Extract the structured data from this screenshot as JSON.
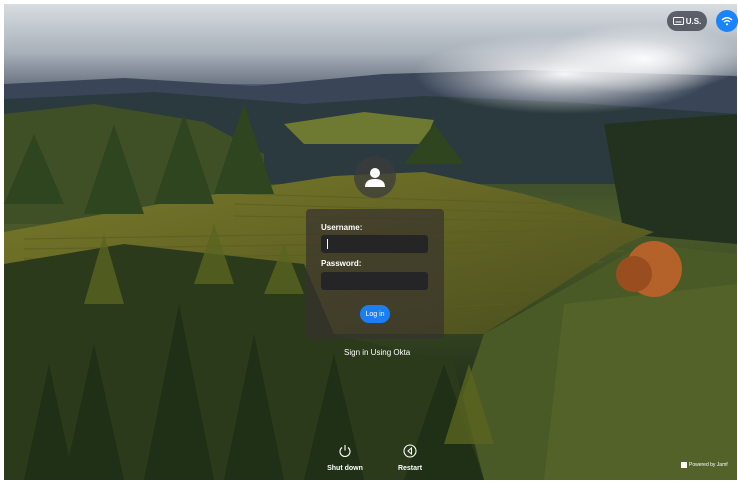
{
  "topbar": {
    "keyboard_layout": "U.S.",
    "icons": [
      "keyboard-icon",
      "wifi-icon"
    ]
  },
  "login": {
    "username_label": "Username:",
    "username_value": "",
    "password_label": "Password:",
    "password_value": "",
    "login_button": "Log in",
    "okta_link": "Sign in Using Okta"
  },
  "footer": {
    "shutdown_label": "Shut down",
    "restart_label": "Restart",
    "powered_by": "Powered by Jamf"
  },
  "colors": {
    "accent": "#1a7ff5",
    "panel": "#3a352e"
  }
}
